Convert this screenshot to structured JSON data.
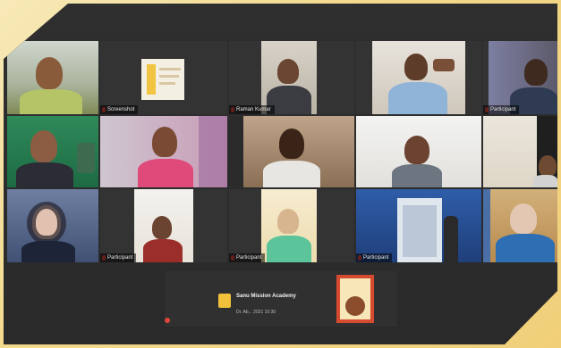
{
  "meeting": {
    "participants": [
      {
        "id": "p1",
        "name": ""
      },
      {
        "id": "p2",
        "name": "Screenshot"
      },
      {
        "id": "p3",
        "name": "Raman Kumar"
      },
      {
        "id": "p4",
        "name": ""
      },
      {
        "id": "p5",
        "name": "Participant"
      },
      {
        "id": "p6",
        "name": ""
      },
      {
        "id": "p7",
        "name": ""
      },
      {
        "id": "p8",
        "name": "Participant"
      },
      {
        "id": "p9",
        "name": ""
      },
      {
        "id": "p10",
        "name": ""
      },
      {
        "id": "p11",
        "name": ""
      },
      {
        "id": "p12",
        "name": "Participant"
      },
      {
        "id": "p13",
        "name": "Participant"
      },
      {
        "id": "p14",
        "name": "Participant"
      },
      {
        "id": "p15",
        "name": ""
      },
      {
        "id": "p16",
        "name": ""
      }
    ],
    "shared_item": {
      "title": "Sanu Mission Academy",
      "subtitle": "Dr. Ab... 2021 10:30"
    }
  },
  "colors": {
    "background": "#f3d98c",
    "panel": "#2f2f2f",
    "muted_mic": "#e0453a",
    "share_icon": "#f2c13b"
  }
}
